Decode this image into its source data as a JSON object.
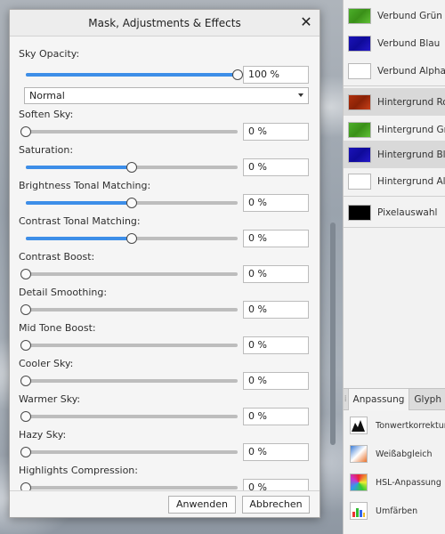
{
  "dialog": {
    "title": "Mask, Adjustments & Effects",
    "blend_mode": "Normal",
    "opacity": {
      "label": "Sky Opacity:",
      "value": "100 %",
      "level": 1.0
    },
    "sliders": [
      {
        "label": "Soften Sky:",
        "value": "0 %",
        "level": 0.0
      },
      {
        "label": "Saturation:",
        "value": "0 %",
        "level": 0.5
      },
      {
        "label": "Brightness Tonal Matching:",
        "value": "0 %",
        "level": 0.5
      },
      {
        "label": "Contrast Tonal Matching:",
        "value": "0 %",
        "level": 0.5
      },
      {
        "label": "Contrast Boost:",
        "value": "0 %",
        "level": 0.0
      },
      {
        "label": "Detail Smoothing:",
        "value": "0 %",
        "level": 0.0
      },
      {
        "label": "Mid Tone Boost:",
        "value": "0 %",
        "level": 0.0
      },
      {
        "label": "Cooler Sky:",
        "value": "0 %",
        "level": 0.0
      },
      {
        "label": "Warmer Sky:",
        "value": "0 %",
        "level": 0.0
      },
      {
        "label": "Hazy Sky:",
        "value": "0 %",
        "level": 0.0
      },
      {
        "label": "Highlights Compression:",
        "value": "0 %",
        "level": 0.0
      }
    ],
    "apply_label": "Anwenden",
    "cancel_label": "Abbrechen",
    "accent_color": "#3d8ee8"
  },
  "layers": [
    {
      "label": "Verbund Grün",
      "swatch": "green"
    },
    {
      "label": "Verbund Blau",
      "swatch": "blue"
    },
    {
      "label": "Verbund Alpha",
      "swatch": "white"
    },
    {
      "label": "Hintergrund Rot",
      "swatch": "red",
      "selected": true
    },
    {
      "label": "Hintergrund Grün",
      "swatch": "green"
    },
    {
      "label": "Hintergrund Blau",
      "swatch": "blue",
      "selected": true
    },
    {
      "label": "Hintergrund Alpha",
      "swatch": "white"
    },
    {
      "label": "Pixelauswahl",
      "swatch": "black"
    }
  ],
  "tabs": [
    "Anpassung",
    "Glyph"
  ],
  "adjustments": [
    {
      "label": "Tonwertkorrektur",
      "icon": "levels-icon"
    },
    {
      "label": "Weißabgleich",
      "icon": "white-balance-icon"
    },
    {
      "label": "HSL-Anpassung",
      "icon": "hsl-icon"
    },
    {
      "label": "Umfärben",
      "icon": "recolor-icon"
    }
  ]
}
